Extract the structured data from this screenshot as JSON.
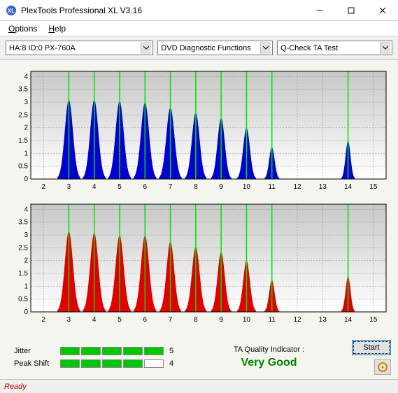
{
  "window": {
    "title": "PlexTools Professional XL V3.16"
  },
  "menu": {
    "options": "Options",
    "help": "Help"
  },
  "selectors": {
    "device": "HA:8 ID:0  PX-760A",
    "function": "DVD Diagnostic Functions",
    "test": "Q-Check TA Test"
  },
  "chart_data": [
    {
      "type": "bar",
      "color": "#0000d0",
      "xlabel": "",
      "ylabel": "",
      "xlim": [
        1.5,
        15.5
      ],
      "ylim": [
        0,
        4.2
      ],
      "xticks": [
        2,
        3,
        4,
        5,
        6,
        7,
        8,
        9,
        10,
        11,
        12,
        13,
        14,
        15
      ],
      "yticks": [
        0,
        0.5,
        1,
        1.5,
        2,
        2.5,
        3,
        3.5,
        4
      ],
      "reference_lines": [
        3,
        4,
        5,
        6,
        7,
        8,
        9,
        10,
        11,
        14
      ],
      "peaks": [
        {
          "x": 3,
          "y": 3.1,
          "w": 0.9
        },
        {
          "x": 4,
          "y": 3.1,
          "w": 0.9
        },
        {
          "x": 5,
          "y": 3.05,
          "w": 0.9
        },
        {
          "x": 6,
          "y": 3.0,
          "w": 0.9
        },
        {
          "x": 7,
          "y": 2.8,
          "w": 0.9
        },
        {
          "x": 8,
          "y": 2.6,
          "w": 0.85
        },
        {
          "x": 9,
          "y": 2.4,
          "w": 0.8
        },
        {
          "x": 10,
          "y": 2.0,
          "w": 0.75
        },
        {
          "x": 11,
          "y": 1.25,
          "w": 0.6
        },
        {
          "x": 14,
          "y": 1.5,
          "w": 0.55
        }
      ]
    },
    {
      "type": "bar",
      "color": "#e00000",
      "xlabel": "",
      "ylabel": "",
      "xlim": [
        1.5,
        15.5
      ],
      "ylim": [
        0,
        4.2
      ],
      "xticks": [
        2,
        3,
        4,
        5,
        6,
        7,
        8,
        9,
        10,
        11,
        12,
        13,
        14,
        15
      ],
      "yticks": [
        0,
        0.5,
        1,
        1.5,
        2,
        2.5,
        3,
        3.5,
        4
      ],
      "reference_lines": [
        3,
        4,
        5,
        6,
        7,
        8,
        9,
        10,
        11,
        14
      ],
      "peaks": [
        {
          "x": 3,
          "y": 3.15,
          "w": 0.9
        },
        {
          "x": 4,
          "y": 3.1,
          "w": 0.9
        },
        {
          "x": 5,
          "y": 3.0,
          "w": 0.9
        },
        {
          "x": 6,
          "y": 3.0,
          "w": 0.9
        },
        {
          "x": 7,
          "y": 2.75,
          "w": 0.85
        },
        {
          "x": 8,
          "y": 2.55,
          "w": 0.85
        },
        {
          "x": 9,
          "y": 2.35,
          "w": 0.8
        },
        {
          "x": 10,
          "y": 2.0,
          "w": 0.75
        },
        {
          "x": 11,
          "y": 1.25,
          "w": 0.6
        },
        {
          "x": 14,
          "y": 1.4,
          "w": 0.55
        }
      ]
    }
  ],
  "metrics": {
    "jitter": {
      "label": "Jitter",
      "value": "5",
      "filled": 5,
      "total": 5
    },
    "peak_shift": {
      "label": "Peak Shift",
      "value": "4",
      "filled": 4,
      "total": 5
    }
  },
  "quality": {
    "label": "TA Quality Indicator :",
    "value": "Very Good"
  },
  "buttons": {
    "start": "Start"
  },
  "status": "Ready"
}
